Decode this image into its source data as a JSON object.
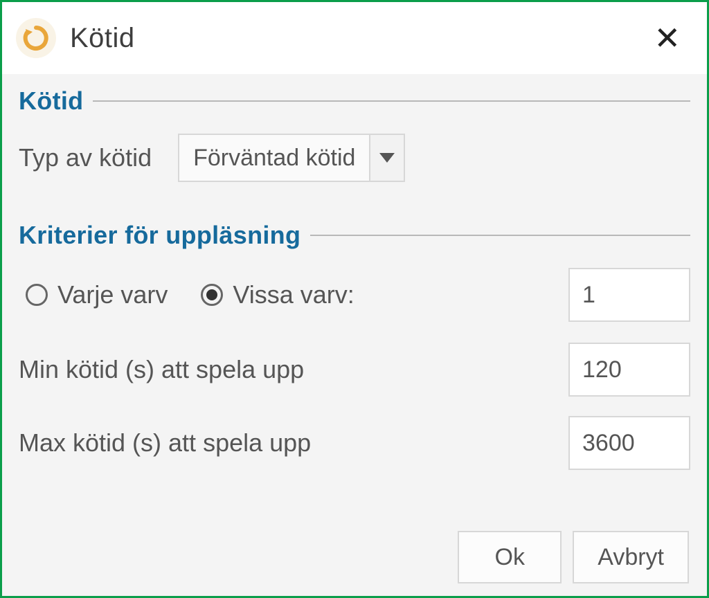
{
  "dialog": {
    "title": "Kötid",
    "close_glyph": "✕"
  },
  "section1": {
    "title": "Kötid",
    "type_label": "Typ av kötid",
    "type_value": "Förväntad kötid"
  },
  "section2": {
    "title": "Kriterier för uppläsning",
    "radio_every": "Varje varv",
    "radio_some": "Vissa varv:",
    "some_value": "1",
    "min_label": "Min kötid (s) att spela upp",
    "min_value": "120",
    "max_label": "Max kötid (s) att spela upp",
    "max_value": "3600"
  },
  "buttons": {
    "ok": "Ok",
    "cancel": "Avbryt"
  }
}
